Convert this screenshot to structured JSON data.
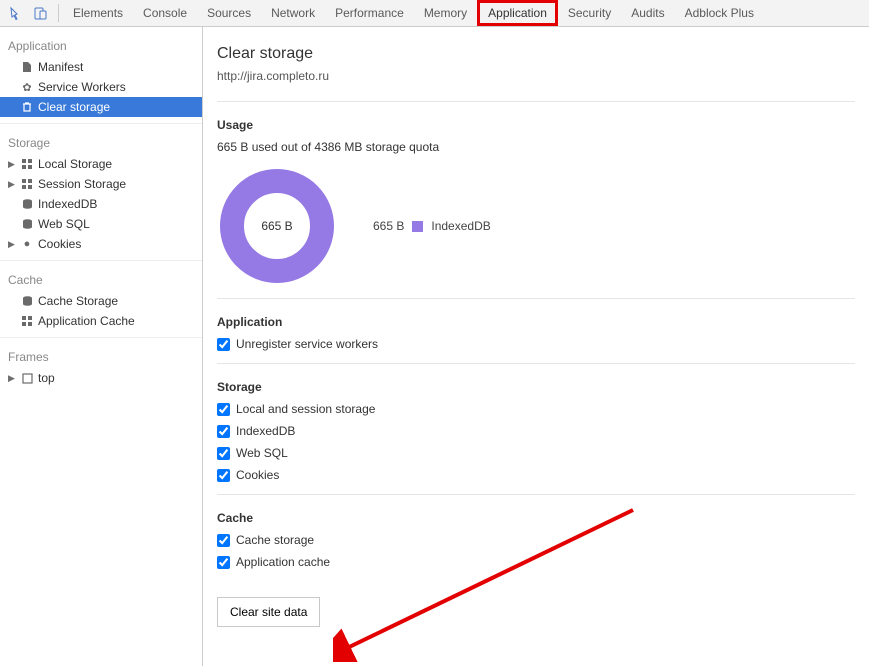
{
  "tabs": [
    "Elements",
    "Console",
    "Sources",
    "Network",
    "Performance",
    "Memory",
    "Application",
    "Security",
    "Audits",
    "Adblock Plus"
  ],
  "active_tab_index": 6,
  "sidebar": {
    "application": {
      "title": "Application",
      "items": [
        {
          "label": "Manifest",
          "icon": "file"
        },
        {
          "label": "Service Workers",
          "icon": "gear"
        },
        {
          "label": "Clear storage",
          "icon": "trash",
          "selected": true
        }
      ]
    },
    "storage": {
      "title": "Storage",
      "items": [
        {
          "label": "Local Storage",
          "icon": "grid",
          "expandable": true
        },
        {
          "label": "Session Storage",
          "icon": "grid",
          "expandable": true
        },
        {
          "label": "IndexedDB",
          "icon": "db"
        },
        {
          "label": "Web SQL",
          "icon": "db"
        },
        {
          "label": "Cookies",
          "icon": "cookie",
          "expandable": true
        }
      ]
    },
    "cache": {
      "title": "Cache",
      "items": [
        {
          "label": "Cache Storage",
          "icon": "db"
        },
        {
          "label": "Application Cache",
          "icon": "grid"
        }
      ]
    },
    "frames": {
      "title": "Frames",
      "items": [
        {
          "label": "top",
          "icon": "frame",
          "expandable": true
        }
      ]
    }
  },
  "page": {
    "title": "Clear storage",
    "origin": "http://jira.completo.ru",
    "usage": {
      "heading": "Usage",
      "summary": "665 B used out of 4386 MB storage quota",
      "total_label": "665 B",
      "legend_value": "665 B",
      "legend_label": "IndexedDB"
    },
    "app_section": {
      "heading": "Application",
      "items": [
        "Unregister service workers"
      ]
    },
    "storage_section": {
      "heading": "Storage",
      "items": [
        "Local and session storage",
        "IndexedDB",
        "Web SQL",
        "Cookies"
      ]
    },
    "cache_section": {
      "heading": "Cache",
      "items": [
        "Cache storage",
        "Application cache"
      ]
    },
    "clear_button": "Clear site data"
  },
  "chart_data": {
    "type": "pie",
    "title": "Storage usage",
    "slices": [
      {
        "name": "IndexedDB",
        "value": 665,
        "unit": "B",
        "color": "#9579e4"
      }
    ],
    "center_label": "665 B"
  },
  "colors": {
    "accent": "#9579e4",
    "selection": "#3879d9",
    "annotation": "#e20000"
  }
}
